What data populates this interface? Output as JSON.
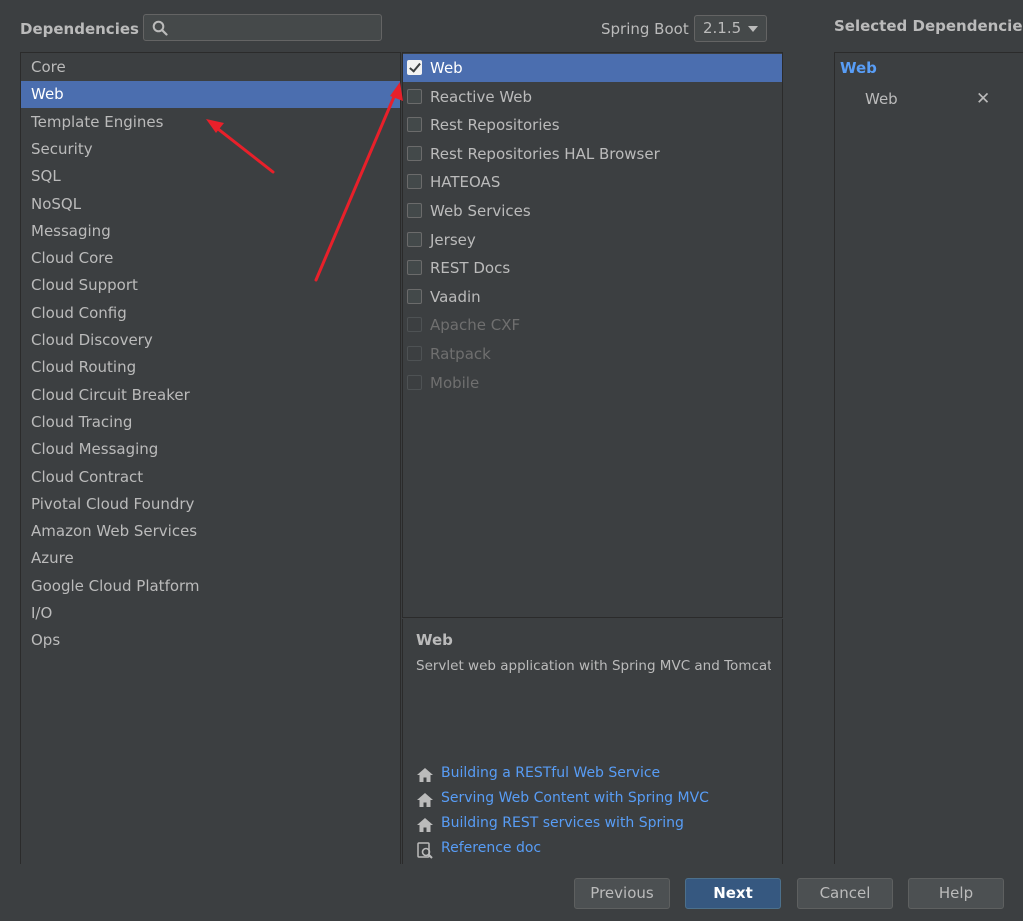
{
  "header": {
    "dependencies_label": "Dependencies",
    "search_placeholder": "",
    "spring_boot_label": "Spring Boot",
    "spring_boot_version": "2.1.5",
    "selected_label": "Selected Dependencies"
  },
  "categories": [
    {
      "label": "Core",
      "selected": false
    },
    {
      "label": "Web",
      "selected": true
    },
    {
      "label": "Template Engines",
      "selected": false
    },
    {
      "label": "Security",
      "selected": false
    },
    {
      "label": "SQL",
      "selected": false
    },
    {
      "label": "NoSQL",
      "selected": false
    },
    {
      "label": "Messaging",
      "selected": false
    },
    {
      "label": "Cloud Core",
      "selected": false
    },
    {
      "label": "Cloud Support",
      "selected": false
    },
    {
      "label": "Cloud Config",
      "selected": false
    },
    {
      "label": "Cloud Discovery",
      "selected": false
    },
    {
      "label": "Cloud Routing",
      "selected": false
    },
    {
      "label": "Cloud Circuit Breaker",
      "selected": false
    },
    {
      "label": "Cloud Tracing",
      "selected": false
    },
    {
      "label": "Cloud Messaging",
      "selected": false
    },
    {
      "label": "Cloud Contract",
      "selected": false
    },
    {
      "label": "Pivotal Cloud Foundry",
      "selected": false
    },
    {
      "label": "Amazon Web Services",
      "selected": false
    },
    {
      "label": "Azure",
      "selected": false
    },
    {
      "label": "Google Cloud Platform",
      "selected": false
    },
    {
      "label": "I/O",
      "selected": false
    },
    {
      "label": "Ops",
      "selected": false
    }
  ],
  "dependencies": [
    {
      "label": "Web",
      "checked": true,
      "enabled": true,
      "selected": true
    },
    {
      "label": "Reactive Web",
      "checked": false,
      "enabled": true,
      "selected": false
    },
    {
      "label": "Rest Repositories",
      "checked": false,
      "enabled": true,
      "selected": false
    },
    {
      "label": "Rest Repositories HAL Browser",
      "checked": false,
      "enabled": true,
      "selected": false
    },
    {
      "label": "HATEOAS",
      "checked": false,
      "enabled": true,
      "selected": false
    },
    {
      "label": "Web Services",
      "checked": false,
      "enabled": true,
      "selected": false
    },
    {
      "label": "Jersey",
      "checked": false,
      "enabled": true,
      "selected": false
    },
    {
      "label": "REST Docs",
      "checked": false,
      "enabled": true,
      "selected": false
    },
    {
      "label": "Vaadin",
      "checked": false,
      "enabled": true,
      "selected": false
    },
    {
      "label": "Apache CXF",
      "checked": false,
      "enabled": false,
      "selected": false
    },
    {
      "label": "Ratpack",
      "checked": false,
      "enabled": false,
      "selected": false
    },
    {
      "label": "Mobile",
      "checked": false,
      "enabled": false,
      "selected": false
    }
  ],
  "description": {
    "title": "Web",
    "text": "Servlet web application with Spring MVC and Tomcat",
    "links": [
      {
        "label": "Building a RESTful Web Service",
        "icon": "home-icon"
      },
      {
        "label": "Serving Web Content with Spring MVC",
        "icon": "home-icon"
      },
      {
        "label": "Building REST services with Spring",
        "icon": "home-icon"
      },
      {
        "label": "Reference doc",
        "icon": "reference-doc-icon"
      }
    ]
  },
  "selected": {
    "group": "Web",
    "items": [
      {
        "label": "Web"
      }
    ]
  },
  "buttons": {
    "previous": "Previous",
    "next": "Next",
    "cancel": "Cancel",
    "help": "Help"
  },
  "colors": {
    "background": "#3c3f41",
    "selection": "#4b6eaf",
    "link": "#589df6",
    "annotation_arrow": "#e8202a"
  }
}
